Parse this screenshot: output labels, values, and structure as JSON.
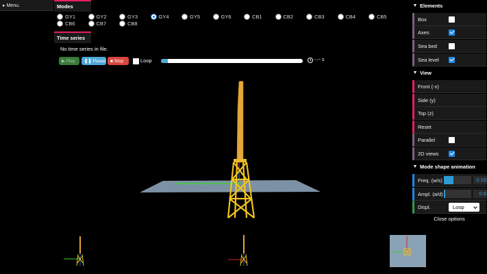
{
  "menu": {
    "label": "Menu."
  },
  "modes": {
    "title": "Modes",
    "row1": [
      "GY1",
      "GY2",
      "GY3",
      "GY4",
      "GY5",
      "GY6",
      "CB1",
      "CB2",
      "CB3",
      "CB4",
      "CB5"
    ],
    "row2": [
      "CB6",
      "CB7",
      "CB8"
    ],
    "selected": "GY4"
  },
  "time_series": {
    "title": "Time series",
    "message": "No time series in file.",
    "play_label": "Play",
    "pause_label": "Pause",
    "stop_label": "Stop",
    "loop_label": "Loop",
    "loop_checked": false,
    "time_readout": "-.-- s"
  },
  "elements": {
    "title": "Elements",
    "items": [
      {
        "label": "Box",
        "checked": false
      },
      {
        "label": "Axes",
        "checked": true
      },
      {
        "label": "Sea bed",
        "checked": false
      },
      {
        "label": "Sea level",
        "checked": true
      }
    ]
  },
  "view": {
    "title": "View",
    "front": "Front (-x)",
    "side": "Side (y)",
    "top": "Top (z)",
    "reset": "Reset",
    "parallel_label": "Parallel",
    "parallel_checked": false,
    "views2d_label": "2D views",
    "views2d_checked": true
  },
  "animation": {
    "title": "Mode shape animation",
    "freq_label": "Freq. (w/s)",
    "freq_value": "0.16",
    "freq_fraction": 0.35,
    "ampl_label": "Ampl. (a/d)",
    "ampl_value": "0.6",
    "ampl_fraction": 0.05,
    "displ_label": "Displ.",
    "displ_value": "Loop"
  },
  "close_options": "Close options",
  "colors": {
    "accent_pink": "#e91e63",
    "accent_blue": "#1e88e5",
    "tower": "#e0a83a",
    "jacket": "#f2c21e",
    "sea": "#8fa8bf"
  }
}
